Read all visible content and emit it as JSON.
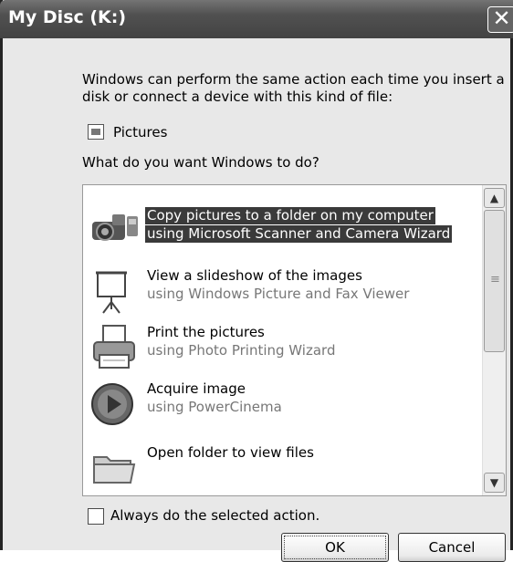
{
  "window": {
    "title": "My Disc (K:)",
    "close_label": "✕"
  },
  "intro_text": "Windows can perform the same action each time you insert a disk or connect a device with this kind of file:",
  "file_type": {
    "icon": "picture-file-icon",
    "label": "Pictures"
  },
  "question": "What do you want Windows to do?",
  "actions": [
    {
      "icon": "camera-icon",
      "title": "Copy pictures to a folder on my computer",
      "subtitle": "using Microsoft Scanner and Camera Wizard",
      "selected": true
    },
    {
      "icon": "projector-screen-icon",
      "title": "View a slideshow of the images",
      "subtitle": "using Windows Picture and Fax Viewer",
      "selected": false
    },
    {
      "icon": "printer-icon",
      "title": "Print the pictures",
      "subtitle": "using Photo Printing Wizard",
      "selected": false
    },
    {
      "icon": "play-icon",
      "title": "Acquire image",
      "subtitle": "using PowerCinema",
      "selected": false
    },
    {
      "icon": "folder-icon",
      "title": "Open folder to view files",
      "subtitle": "",
      "selected": false
    }
  ],
  "always_checkbox": {
    "label": "Always do the selected action.",
    "checked": false
  },
  "buttons": {
    "ok": "OK",
    "cancel": "Cancel"
  }
}
